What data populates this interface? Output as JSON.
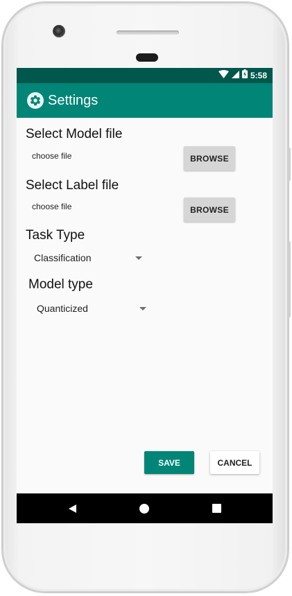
{
  "status_bar": {
    "time": "5:58",
    "icons": [
      "wifi-icon",
      "signal-icon",
      "battery-icon"
    ]
  },
  "app_bar": {
    "icon": "gear-icon",
    "title": "Settings"
  },
  "model_file": {
    "label": "Select Model file",
    "value": "choose file",
    "button": "BROWSE"
  },
  "label_file": {
    "label": "Select Label file",
    "value": "choose file",
    "button": "BROWSE"
  },
  "task_type": {
    "label": "Task Type",
    "selected": "Classification"
  },
  "model_type": {
    "label": "Model type",
    "selected": "Quanticized"
  },
  "actions": {
    "save": "SAVE",
    "cancel": "CANCEL"
  },
  "nav_bar": {
    "items": [
      "back-icon",
      "home-icon",
      "recents-icon"
    ]
  },
  "colors": {
    "primary": "#008577",
    "primary_dark": "#00574b",
    "background": "#fafafa"
  }
}
